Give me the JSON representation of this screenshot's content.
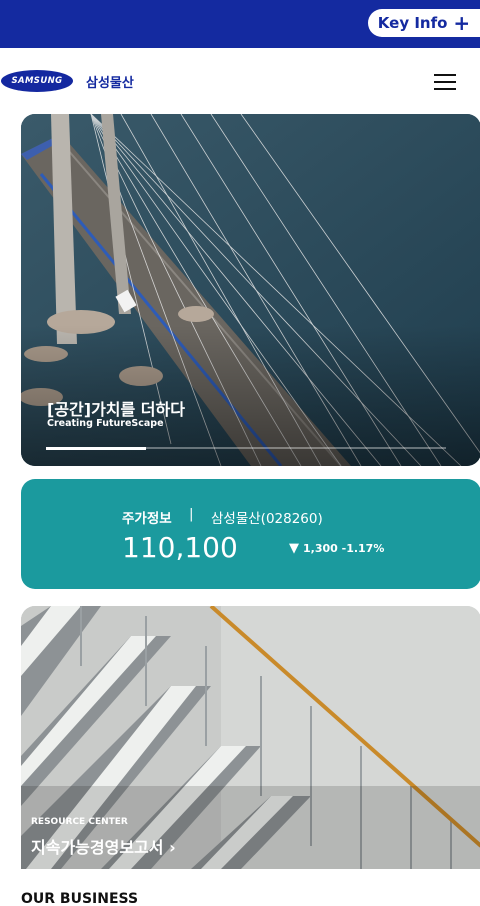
{
  "topbar": {
    "key_info_label": "Key Info",
    "plus_icon": "+"
  },
  "header": {
    "logo_text": "SAMSUNG",
    "company_name": "삼성물산",
    "menu_icon": "hamburger-menu-icon"
  },
  "hero": {
    "title": "[공간]가치를 더하다",
    "subtitle": "Creating FutureScape",
    "slide_progress": 0.25
  },
  "stock": {
    "label": "주가정보",
    "separator": "|",
    "company": "삼성물산(028260)",
    "price": "110,100",
    "change_icon": "▼",
    "change": "1,300 -1.17%"
  },
  "resource": {
    "tag": "RESOURCE CENTER",
    "title": "지속가능경영보고서",
    "arrow": "›"
  },
  "section": {
    "heading": "OUR BUSINESS"
  },
  "colors": {
    "brand_blue": "#142aa0",
    "stock_teal": "#1b9a9e"
  }
}
